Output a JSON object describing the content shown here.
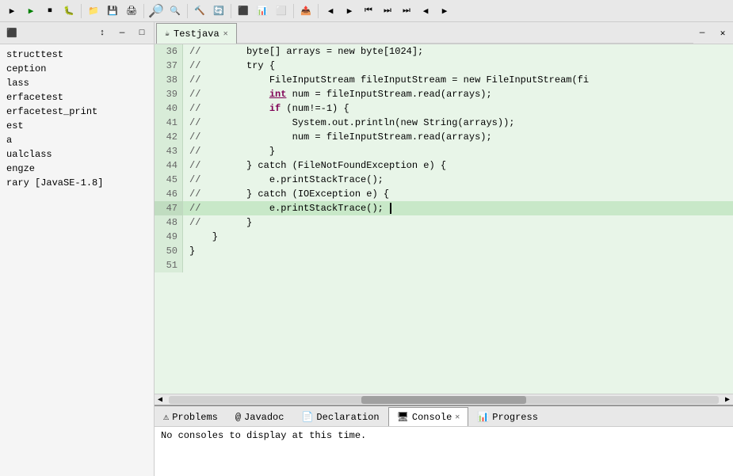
{
  "toolbar": {
    "buttons": [
      "▶",
      "▶",
      "⏹",
      "●",
      "⚙",
      "📋",
      "📋",
      "✂",
      "📋",
      "🔍",
      "🔍",
      "🔨",
      "🔄",
      "⬛",
      "📊",
      "⬜",
      "📤",
      "◀",
      "▶",
      "⏮",
      "⏭",
      "⏭",
      "◀",
      "▶"
    ]
  },
  "sidebar": {
    "toolbar_buttons": [
      "⬛",
      "↕",
      "↔",
      "✕",
      "—",
      "□"
    ],
    "items": [
      "structtest",
      "ception",
      "lass",
      "erfacetest",
      "erfacetest_print",
      "est",
      "a",
      "ualclass",
      "engze",
      "rary [JavaSE-1.8]"
    ]
  },
  "editor": {
    "tab_label": "Testjava",
    "tab_icon": "☕",
    "lines": [
      {
        "num": 36,
        "content": "        byte[] arrays = new byte[1024];"
      },
      {
        "num": 37,
        "content": "        try {"
      },
      {
        "num": 38,
        "content": "            FileInputStream fileInputStream = new FileInputStream(fi"
      },
      {
        "num": 39,
        "content": "            int num = fileInputStream.read(arrays);"
      },
      {
        "num": 40,
        "content": "            if (num!=-1) {"
      },
      {
        "num": 41,
        "content": "                System.out.println(new String(arrays));"
      },
      {
        "num": 42,
        "content": "                num = fileInputStream.read(arrays);"
      },
      {
        "num": 43,
        "content": "            }"
      },
      {
        "num": 44,
        "content": "        } catch (FileNotFoundException e) {"
      },
      {
        "num": 45,
        "content": "            e.printStackTrace();"
      },
      {
        "num": 46,
        "content": "        } catch (IOException e) {"
      },
      {
        "num": 47,
        "content": "            e.printStackTrace();",
        "cursor": true
      },
      {
        "num": 48,
        "content": "        }"
      },
      {
        "num": 49,
        "content": "    }"
      },
      {
        "num": 50,
        "content": "}"
      },
      {
        "num": 51,
        "content": ""
      }
    ]
  },
  "bottom_panel": {
    "tabs": [
      {
        "label": "Problems",
        "icon": "⚠"
      },
      {
        "label": "@ Javadoc",
        "icon": ""
      },
      {
        "label": "Declaration",
        "icon": "📄"
      },
      {
        "label": "Console",
        "icon": "🖥",
        "active": true
      },
      {
        "label": "Progress",
        "icon": "📊"
      }
    ],
    "active_tab": "Console",
    "console_message": "No consoles to display at this time."
  }
}
